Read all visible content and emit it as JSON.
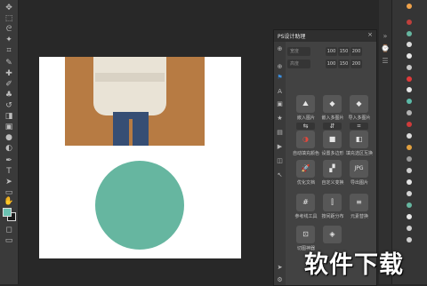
{
  "panel": {
    "title": "PS设计助理",
    "close": "×",
    "zoom_rows": [
      {
        "placeholder": "宽度",
        "buttons": [
          "100",
          "150",
          "200"
        ]
      },
      {
        "placeholder": "高度",
        "buttons": [
          "100",
          "150",
          "200"
        ]
      }
    ],
    "tiles": [
      {
        "glyph": "⛰",
        "label": "嵌入图片"
      },
      {
        "glyph": "◆",
        "label": "嵌入多图片"
      },
      {
        "glyph": "◆",
        "label": "导入多图片"
      },
      {
        "glyph": "⇆",
        "label": ""
      },
      {
        "glyph": "⇵",
        "label": ""
      },
      {
        "glyph": "⌗",
        "label": ""
      },
      {
        "glyph": "◑",
        "label": "自动填充颜色"
      },
      {
        "glyph": "■",
        "label": "设置多边形"
      },
      {
        "glyph": "◧",
        "label": "填充选区互换"
      },
      {
        "glyph": "🚀",
        "label": "优化文档"
      },
      {
        "glyph": "▞",
        "label": "自定义变换"
      },
      {
        "glyph": "JPG",
        "label": "导出图片"
      },
      {
        "glyph": "#",
        "label": "参考线工具"
      },
      {
        "glyph": "⫿",
        "label": "按间距分布"
      },
      {
        "glyph": "≡",
        "label": "元素替换"
      },
      {
        "glyph": "⊡",
        "label": "切图神器"
      },
      {
        "glyph": "◈",
        "label": ""
      }
    ]
  },
  "watermark": "软件下载",
  "colors": {
    "app_bg": "#282828",
    "panel_bg": "#424242",
    "tile_bg": "#575757",
    "circle": "#66b6a0",
    "photo_bg": "#b77b43"
  },
  "toolbar_icons": [
    "move-icon",
    "marquee-icon",
    "lasso-icon",
    "magic-wand-icon",
    "crop-icon",
    "eyedropper-icon",
    "healing-icon",
    "brush-icon",
    "stamp-icon",
    "history-brush-icon",
    "eraser-icon",
    "gradient-icon",
    "blur-icon",
    "dodge-icon",
    "pen-icon",
    "type-icon",
    "path-select-icon",
    "shape-icon",
    "hand-icon",
    "zoom-icon"
  ]
}
